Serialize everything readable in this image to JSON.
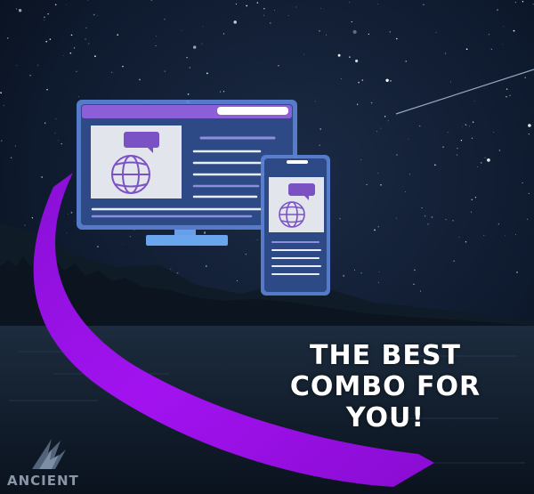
{
  "headline": {
    "line1": "THE BEST",
    "line2": "COMBO FOR",
    "line3": "YOU!"
  },
  "brand": {
    "name": "ANCIENT"
  },
  "colors": {
    "sky": "#0a1220",
    "ribbon": "#9a0ee0",
    "device_frame": "#5a7fd0",
    "device_screen": "#2d4a86",
    "browser_bar": "#8c5fd8",
    "card_bg": "#e2e6ec",
    "globe_icon": "#7b52c4",
    "text_lines": "#e9edf6"
  },
  "icons": {
    "desktop": "desktop-monitor-icon",
    "phone": "smartphone-icon",
    "globe": "globe-icon",
    "chat": "chat-bubble-icon",
    "logo": "ancient-wing-logo-icon"
  }
}
